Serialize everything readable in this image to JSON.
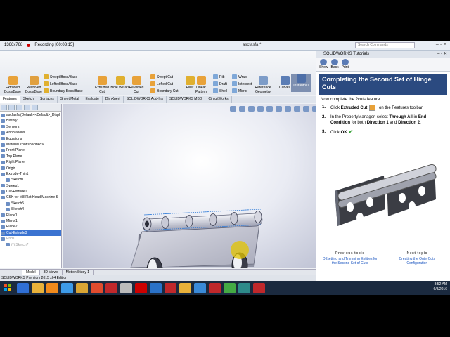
{
  "recorder": {
    "resolution": "1366x768",
    "status": "Recording [00:03:15]",
    "window_title": "ascfasfa *",
    "search_placeholder": "Search Commands"
  },
  "commands": {
    "large": [
      {
        "label": "Extruded Boss/Base",
        "icon": "extruded-boss-icon"
      },
      {
        "label": "Revolved Boss/Base",
        "icon": "revolved-boss-icon"
      },
      {
        "label": "Extruded Cut",
        "icon": "extruded-cut-icon"
      },
      {
        "label": "Hole Wizard",
        "icon": "hole-wizard-icon"
      },
      {
        "label": "Revolved Cut",
        "icon": "revolved-cut-icon"
      },
      {
        "label": "Fillet",
        "icon": "fillet-icon"
      },
      {
        "label": "Linear Pattern",
        "icon": "linear-pattern-icon"
      },
      {
        "label": "Reference Geometry",
        "icon": "reference-geometry-icon"
      },
      {
        "label": "Curves",
        "icon": "curves-icon"
      },
      {
        "label": "Instant3D",
        "icon": "instant3d-icon"
      }
    ],
    "small": [
      "Swept Boss/Base",
      "Lofted Boss/Base",
      "Boundary Boss/Base",
      "Swept Cut",
      "Lofted Cut",
      "Boundary Cut",
      "Rib",
      "Draft",
      "Shell",
      "Wrap",
      "Intersect",
      "Mirror"
    ]
  },
  "cmd_tabs": [
    "Features",
    "Sketch",
    "Surfaces",
    "Sheet Metal",
    "Evaluate",
    "DimXpert",
    "SOLIDWORKS Add-Ins",
    "SOLIDWORKS MBD",
    "CircuitWorks"
  ],
  "feature_tree": [
    {
      "label": "ascfasfa (Default<<Default>_Displ",
      "state": "normal"
    },
    {
      "label": "History",
      "state": "normal"
    },
    {
      "label": "Sensors",
      "state": "normal"
    },
    {
      "label": "Annotations",
      "state": "normal"
    },
    {
      "label": "Equations",
      "state": "normal"
    },
    {
      "label": "Material <not specified>",
      "state": "normal"
    },
    {
      "label": "Front Plane",
      "state": "normal"
    },
    {
      "label": "Top Plane",
      "state": "normal"
    },
    {
      "label": "Right Plane",
      "state": "normal"
    },
    {
      "label": "Origin",
      "state": "normal"
    },
    {
      "label": "Extrude-Thin1",
      "state": "normal"
    },
    {
      "label": "Sketch1",
      "state": "normal"
    },
    {
      "label": "Sweep1",
      "state": "normal"
    },
    {
      "label": "Cut-Extrude1",
      "state": "normal"
    },
    {
      "label": "CSK for M8 Flat Head Machine S",
      "state": "normal"
    },
    {
      "label": "Sketch5",
      "state": "normal"
    },
    {
      "label": "Sketch4",
      "state": "normal"
    },
    {
      "label": "Plane1",
      "state": "normal"
    },
    {
      "label": "Mirror1",
      "state": "normal"
    },
    {
      "label": "Plane2",
      "state": "normal"
    },
    {
      "label": "Cut-Extrude3",
      "state": "selected"
    },
    {
      "label": "Ends",
      "state": "dim"
    },
    {
      "label": "(-) Sketch7",
      "state": "dim"
    }
  ],
  "model_tabs": [
    "Model",
    "3D Views",
    "Motion Study 1"
  ],
  "status_text": "SOLIDWORKS Premium 2015 x64 Edition",
  "tutorial": {
    "window_title": "SOLIDWORKS Tutorials",
    "nav": [
      "Show",
      "Back",
      "Print"
    ],
    "heading": "Completing the Second Set of Hinge Cuts",
    "intro": "Now complete the 2cuts feature.",
    "steps": [
      {
        "num": "1.",
        "parts": [
          "Click ",
          "Extruded Cut",
          " on the Features toolbar."
        ]
      },
      {
        "num": "2.",
        "parts": [
          "In the PropertyManager, select ",
          "Through All",
          " in ",
          "End Condition",
          " for both ",
          "Direction 1",
          " and ",
          "Direction 2",
          "."
        ]
      },
      {
        "num": "3.",
        "parts": [
          "Click ",
          "OK",
          ""
        ]
      }
    ],
    "prev_heading": "Previous topic",
    "prev_link": "Offsetting and Trimming Entities for the Second Set of Cuts",
    "next_heading": "Next topic",
    "next_link": "Creating the OuterCuts Configuration"
  },
  "taskbar": {
    "time": "8:52 AM",
    "date": "6/8/2016"
  },
  "colors": {
    "tutorial_header": "#2b4a80",
    "selection": "#3b73d1",
    "part_face": "#d2d3dd"
  }
}
